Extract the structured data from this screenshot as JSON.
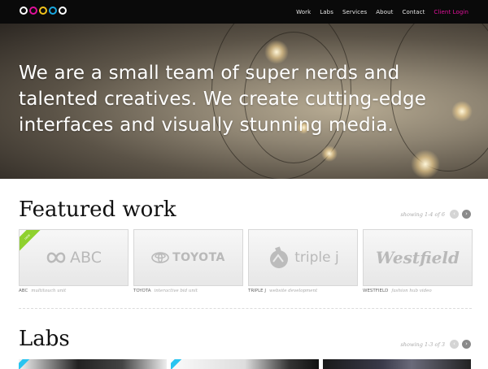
{
  "nav": {
    "items": [
      "Work",
      "Labs",
      "Services",
      "About",
      "Contact"
    ],
    "login": "Client Login"
  },
  "hero": {
    "text": "We are a small team of super nerds and talented creatives. We create cutting-edge interfaces and visually stunning media."
  },
  "featured": {
    "title": "Featured work",
    "showing": "showing 1-4 of 6",
    "cards": [
      {
        "logo": "ABC",
        "name": "ABC",
        "desc": "multitouch unit",
        "ribbon": "new"
      },
      {
        "logo": "TOYOTA",
        "name": "TOYOTA",
        "desc": "interactive bid unit"
      },
      {
        "logo": "triple j",
        "name": "TRIPLE J",
        "desc": "website development"
      },
      {
        "logo": "Westfield",
        "name": "WESTFIELD",
        "desc": "fashion hub video"
      }
    ]
  },
  "labs": {
    "title": "Labs",
    "showing": "showing 1-3 of 3"
  },
  "colors": {
    "topbar": "#0a0a0a",
    "login": "#e0109a",
    "ribbon": "#8fd12e",
    "ribbon_labs": "#29c4f0"
  },
  "icons": {
    "logo": "colored-rings-logo",
    "prev": "chevron-left-icon",
    "next": "chevron-right-icon"
  }
}
